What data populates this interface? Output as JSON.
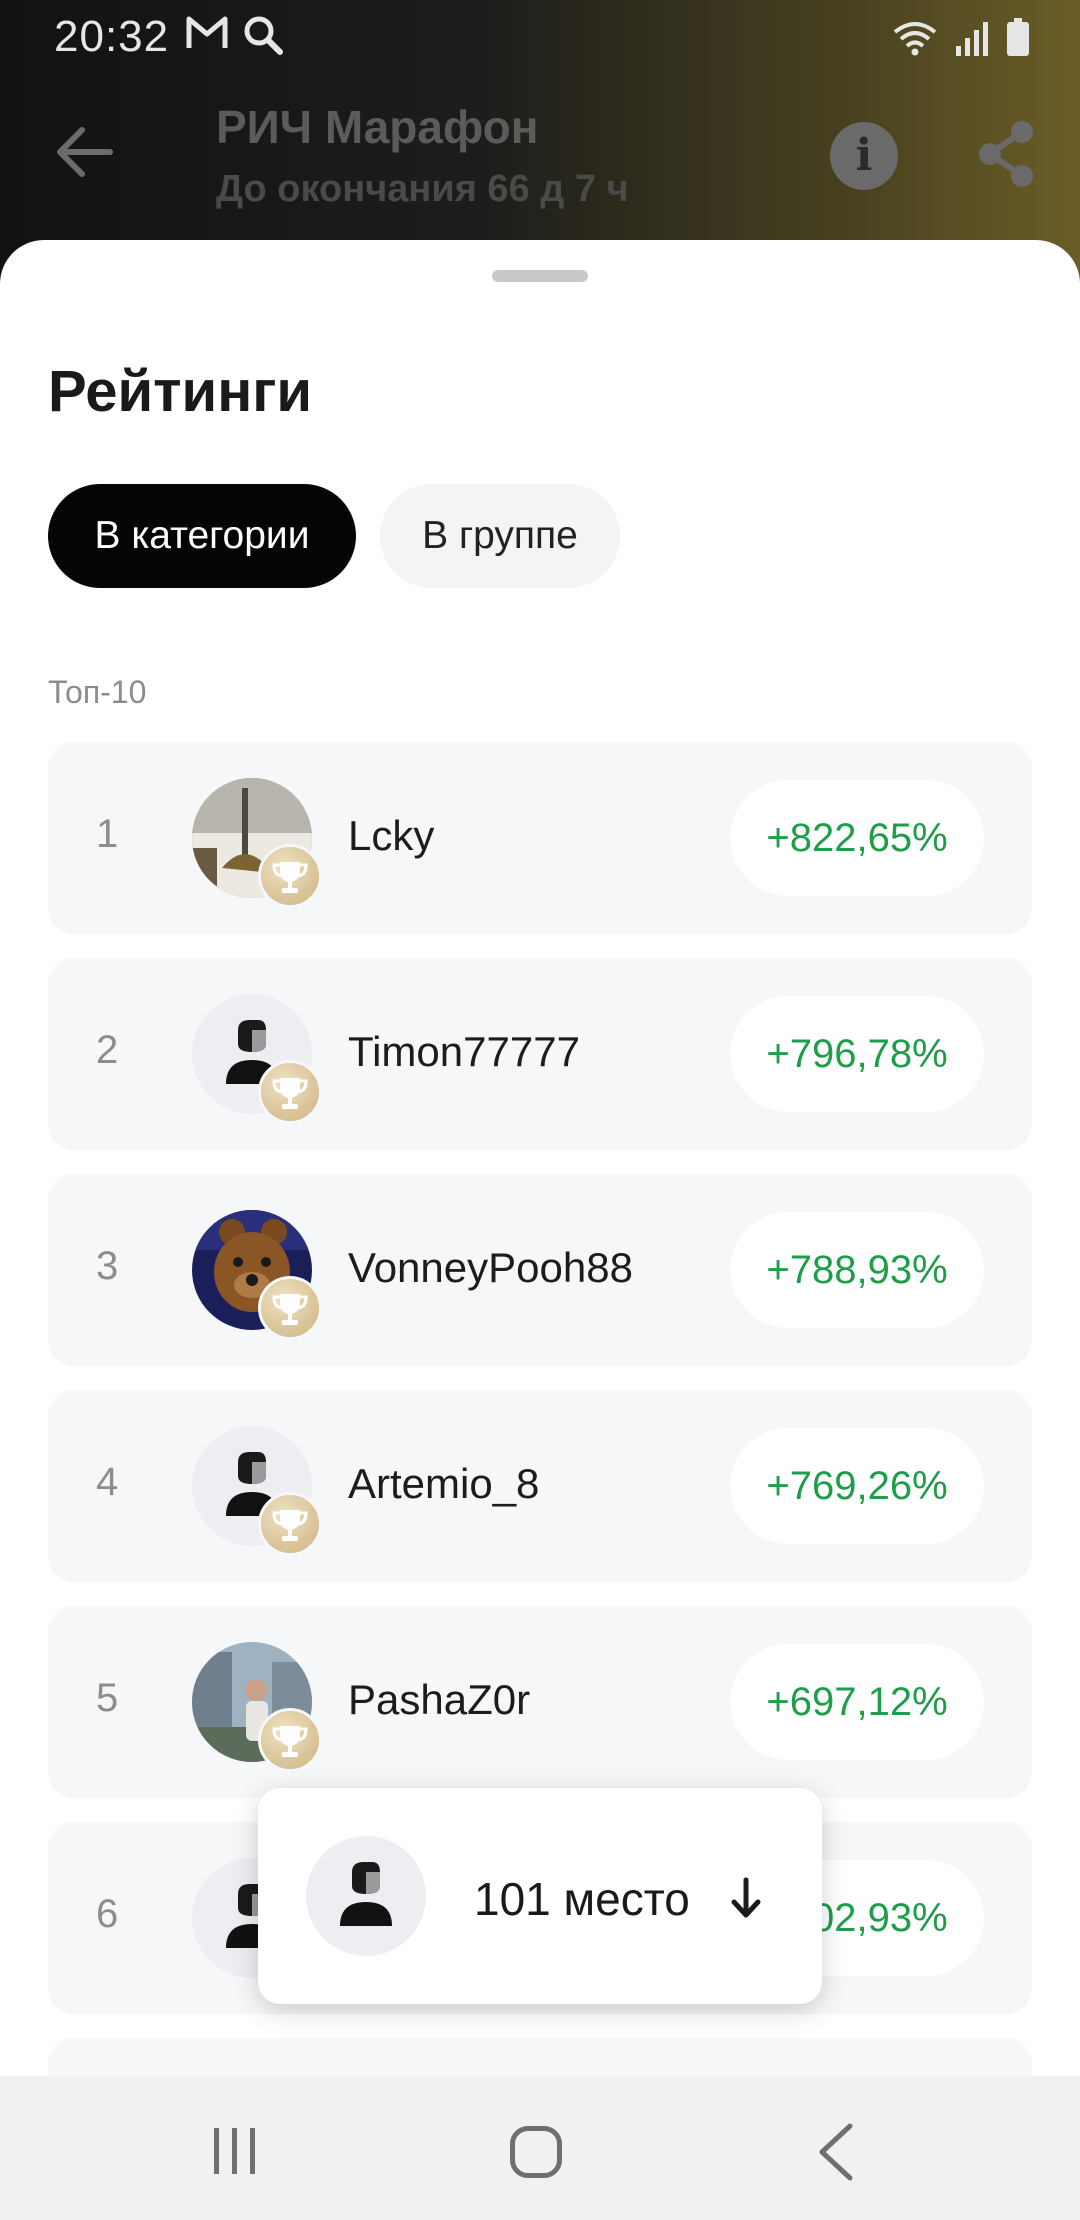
{
  "status_bar": {
    "time": "20:32",
    "left_icons": [
      "gmail-icon",
      "search-icon"
    ],
    "right_icons": [
      "wifi-icon",
      "signal-icon",
      "battery-icon"
    ]
  },
  "header": {
    "title": "РИЧ Марафон",
    "subtitle": "До окончания 66 д 7 ч",
    "icons": [
      "back-arrow-icon",
      "info-icon",
      "share-icon"
    ]
  },
  "sheet": {
    "title": "Рейтинги",
    "tabs": [
      {
        "label": "В категории",
        "active": true
      },
      {
        "label": "В группе",
        "active": false
      }
    ],
    "section_label": "Топ-10",
    "rows": [
      {
        "rank": "1",
        "name": "Lcky",
        "score": "+822,65%",
        "avatar": "photo-snow"
      },
      {
        "rank": "2",
        "name": "Timon77777",
        "score": "+796,78%",
        "avatar": "default"
      },
      {
        "rank": "3",
        "name": "VonneyPooh88",
        "score": "+788,93%",
        "avatar": "photo-bear"
      },
      {
        "rank": "4",
        "name": "Artemio_8",
        "score": "+769,26%",
        "avatar": "default"
      },
      {
        "rank": "5",
        "name": "PashaZ0r",
        "score": "+697,12%",
        "avatar": "photo-city"
      },
      {
        "rank": "6",
        "name": "",
        "score": "+702,93%",
        "avatar": "default"
      }
    ]
  },
  "my_position": {
    "label": "101 место",
    "icon": "arrow-down-icon"
  },
  "colors": {
    "positive": "#1e9d4a",
    "chip_active_bg": "#050505",
    "row_bg": "#f6f7f8"
  },
  "navbar": {
    "icons": [
      "recent-apps-icon",
      "home-icon",
      "nav-back-icon"
    ]
  }
}
